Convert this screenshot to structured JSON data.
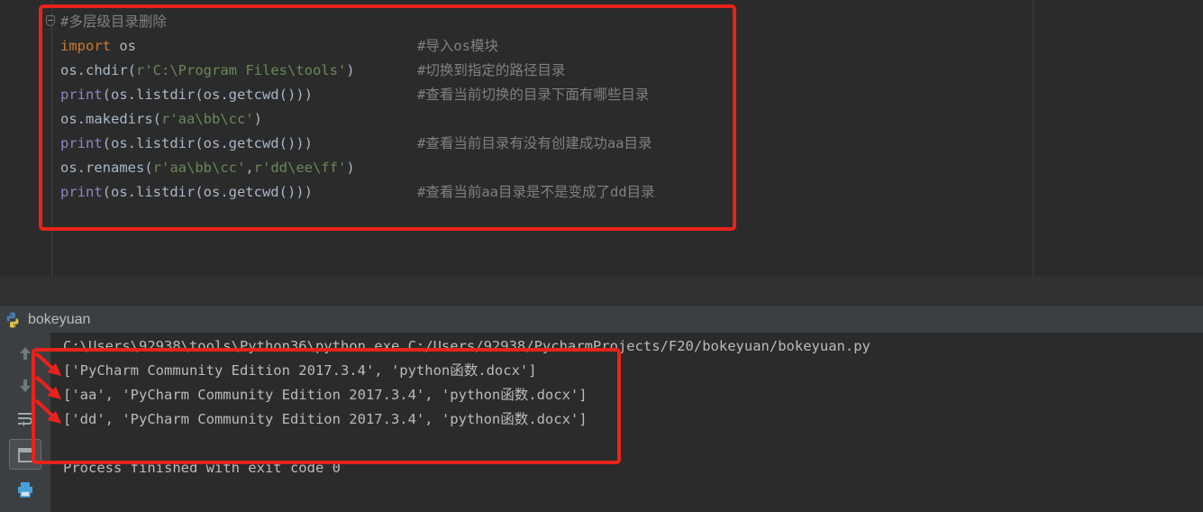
{
  "editor": {
    "header_comment": "#多层级目录删除",
    "lines": [
      {
        "parts": [
          {
            "t": "import",
            "c": "kw"
          },
          {
            "t": " os",
            "c": "plain"
          }
        ],
        "comment": "#导入os模块"
      },
      {
        "parts": [
          {
            "t": "os.chdir(",
            "c": "plain"
          },
          {
            "t": "r'C:\\Program Files\\tools'",
            "c": "str"
          },
          {
            "t": ")",
            "c": "plain"
          }
        ],
        "comment": "#切换到指定的路径目录"
      },
      {
        "parts": [
          {
            "t": "print",
            "c": "fn"
          },
          {
            "t": "(os.listdir(os.getcwd()))",
            "c": "plain"
          }
        ],
        "comment": "#查看当前切换的目录下面有哪些目录"
      },
      {
        "parts": [
          {
            "t": "os.makedirs(",
            "c": "plain"
          },
          {
            "t": "r'aa\\bb\\cc'",
            "c": "str"
          },
          {
            "t": ")",
            "c": "plain"
          }
        ],
        "comment": ""
      },
      {
        "parts": [
          {
            "t": "print",
            "c": "fn"
          },
          {
            "t": "(os.listdir(os.getcwd()))",
            "c": "plain"
          }
        ],
        "comment": "#查看当前目录有没有创建成功aa目录"
      },
      {
        "parts": [
          {
            "t": "os.renames(",
            "c": "plain"
          },
          {
            "t": "r'aa\\bb\\cc'",
            "c": "str"
          },
          {
            "t": ",",
            "c": "plain"
          },
          {
            "t": "r'dd\\ee\\ff'",
            "c": "str"
          },
          {
            "t": ")",
            "c": "plain"
          }
        ],
        "comment": ""
      },
      {
        "parts": [
          {
            "t": "print",
            "c": "fn"
          },
          {
            "t": "(os.listdir(os.getcwd()))",
            "c": "plain"
          }
        ],
        "comment": "#查看当前aa目录是不是变成了dd目录"
      }
    ]
  },
  "run_panel": {
    "title": "bokeyuan",
    "command": "C:\\Users\\92938\\tools\\Python36\\python.exe C:/Users/92938/PycharmProjects/F20/bokeyuan/bokeyuan.py",
    "outputs": [
      "['PyCharm Community Edition 2017.3.4', 'python函数.docx']",
      "['aa', 'PyCharm Community Edition 2017.3.4', 'python函数.docx']",
      "['dd', 'PyCharm Community Edition 2017.3.4', 'python函数.docx']"
    ],
    "exit_message": "Process finished with exit code 0"
  },
  "colors": {
    "annotation_red": "#e8231b",
    "keyword": "#cc7832",
    "builtin": "#8888c6",
    "string": "#6a8759",
    "comment": "#808080"
  },
  "icons": {
    "toolbar": [
      "arrow-up-icon",
      "arrow-down-icon",
      "soft-wrap-icon",
      "scroll-to-end-icon",
      "print-icon"
    ],
    "panel": "python-icon"
  }
}
